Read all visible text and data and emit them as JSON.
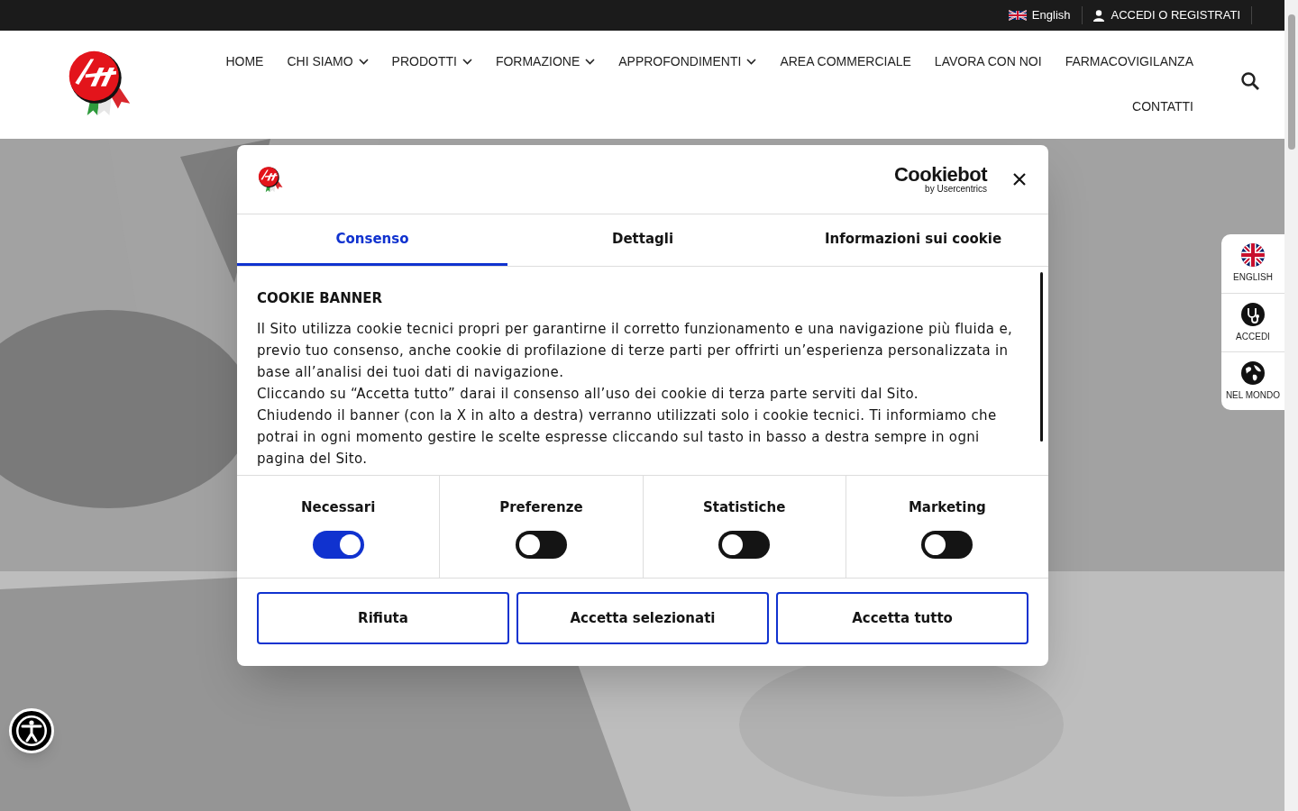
{
  "top_bar": {
    "language": "English",
    "account": "ACCEDI O REGISTRATI"
  },
  "nav": {
    "items": [
      {
        "label": "HOME",
        "dropdown": false
      },
      {
        "label": "CHI SIAMO",
        "dropdown": true
      },
      {
        "label": "PRODOTTI",
        "dropdown": true
      },
      {
        "label": "FORMAZIONE",
        "dropdown": true
      },
      {
        "label": "APPROFONDIMENTI",
        "dropdown": true
      },
      {
        "label": "AREA COMMERCIALE",
        "dropdown": false
      },
      {
        "label": "LAVORA CON NOI",
        "dropdown": false
      },
      {
        "label": "FARMACOVIGILANZA",
        "dropdown": false
      },
      {
        "label": "CONTATTI",
        "dropdown": false
      }
    ]
  },
  "side_widget": [
    {
      "kind": "flag",
      "label": "ENGLISH"
    },
    {
      "kind": "stethoscope",
      "label": "ACCEDI"
    },
    {
      "kind": "globe",
      "label": "NEL MONDO"
    }
  ],
  "dialog": {
    "brand": "Cookiebot",
    "brand_sub": "by Usercentrics",
    "tabs": [
      {
        "label": "Consenso",
        "selected": true
      },
      {
        "label": "Dettagli",
        "selected": false
      },
      {
        "label": "Informazioni sui cookie",
        "selected": false
      }
    ],
    "heading": "COOKIE BANNER",
    "paragraphs": [
      "Il Sito utilizza cookie tecnici propri per garantirne il corretto funzionamento e una navigazione più fluida e, previo tuo consenso, anche cookie di profilazione di terze parti per offrirti un’esperienza personalizzata in base all’analisi dei tuoi dati di navigazione.",
      "Cliccando su “Accetta tutto” darai il consenso all’uso dei cookie di terza parte serviti dal Sito.",
      "Chiudendo il banner (con la X in alto a destra) verranno utilizzati solo i cookie tecnici. Ti informiamo che potrai in ogni momento gestire le scelte espresse cliccando sul tasto in basso a destra sempre in ogni pagina del Sito."
    ],
    "toggles": [
      {
        "label": "Necessari",
        "on": true
      },
      {
        "label": "Preferenze",
        "on": false
      },
      {
        "label": "Statistiche",
        "on": false
      },
      {
        "label": "Marketing",
        "on": false
      }
    ],
    "buttons": [
      "Rifiuta",
      "Accetta selezionati",
      "Accetta tutto"
    ]
  }
}
